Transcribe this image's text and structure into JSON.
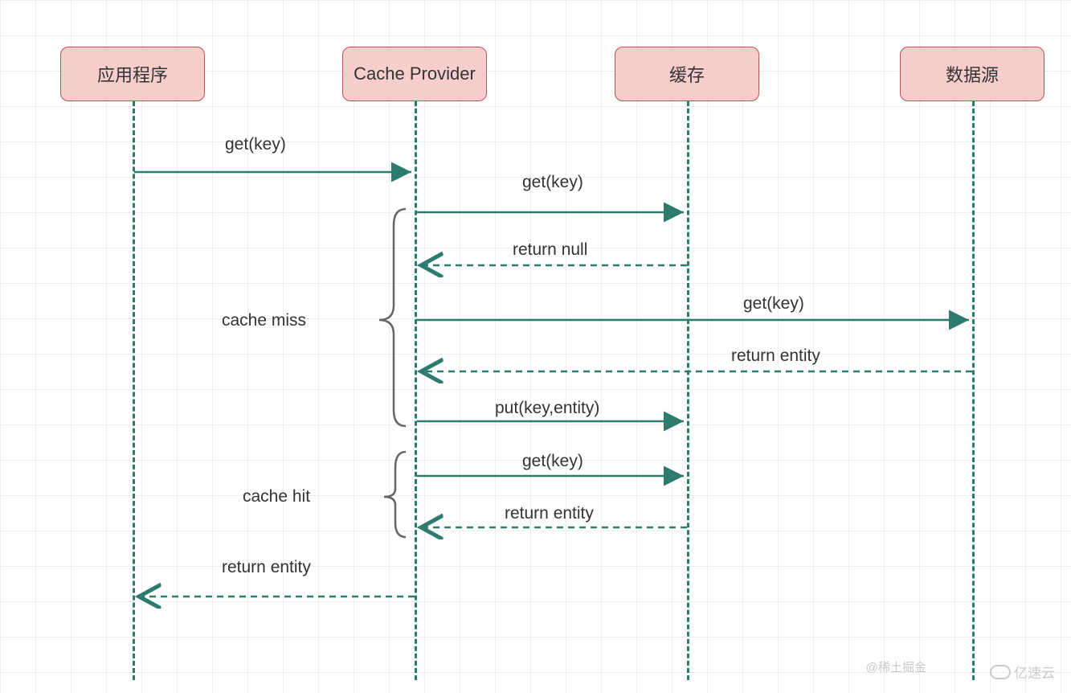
{
  "participants": {
    "app": "应用程序",
    "cache_provider": "Cache Provider",
    "cache": "缓存",
    "datasource": "数据源"
  },
  "messages": {
    "m1": "get(key)",
    "m2": "get(key)",
    "m3": "return null",
    "m4": "get(key)",
    "m5": "return entity",
    "m6": "put(key,entity)",
    "m7": "get(key)",
    "m8": "return entity",
    "m9": "return entity"
  },
  "groups": {
    "miss": "cache miss",
    "hit": "cache hit"
  },
  "colors": {
    "participant_fill": "#f8cecc",
    "participant_border": "#b85450",
    "line": "#2d7a6e",
    "grid": "#eeeeee"
  },
  "lifeline_x": {
    "app": 165,
    "cache_provider": 516,
    "cache": 855,
    "datasource": 1210
  },
  "watermark": {
    "source": "@稀土掘金",
    "brand": "亿速云"
  }
}
